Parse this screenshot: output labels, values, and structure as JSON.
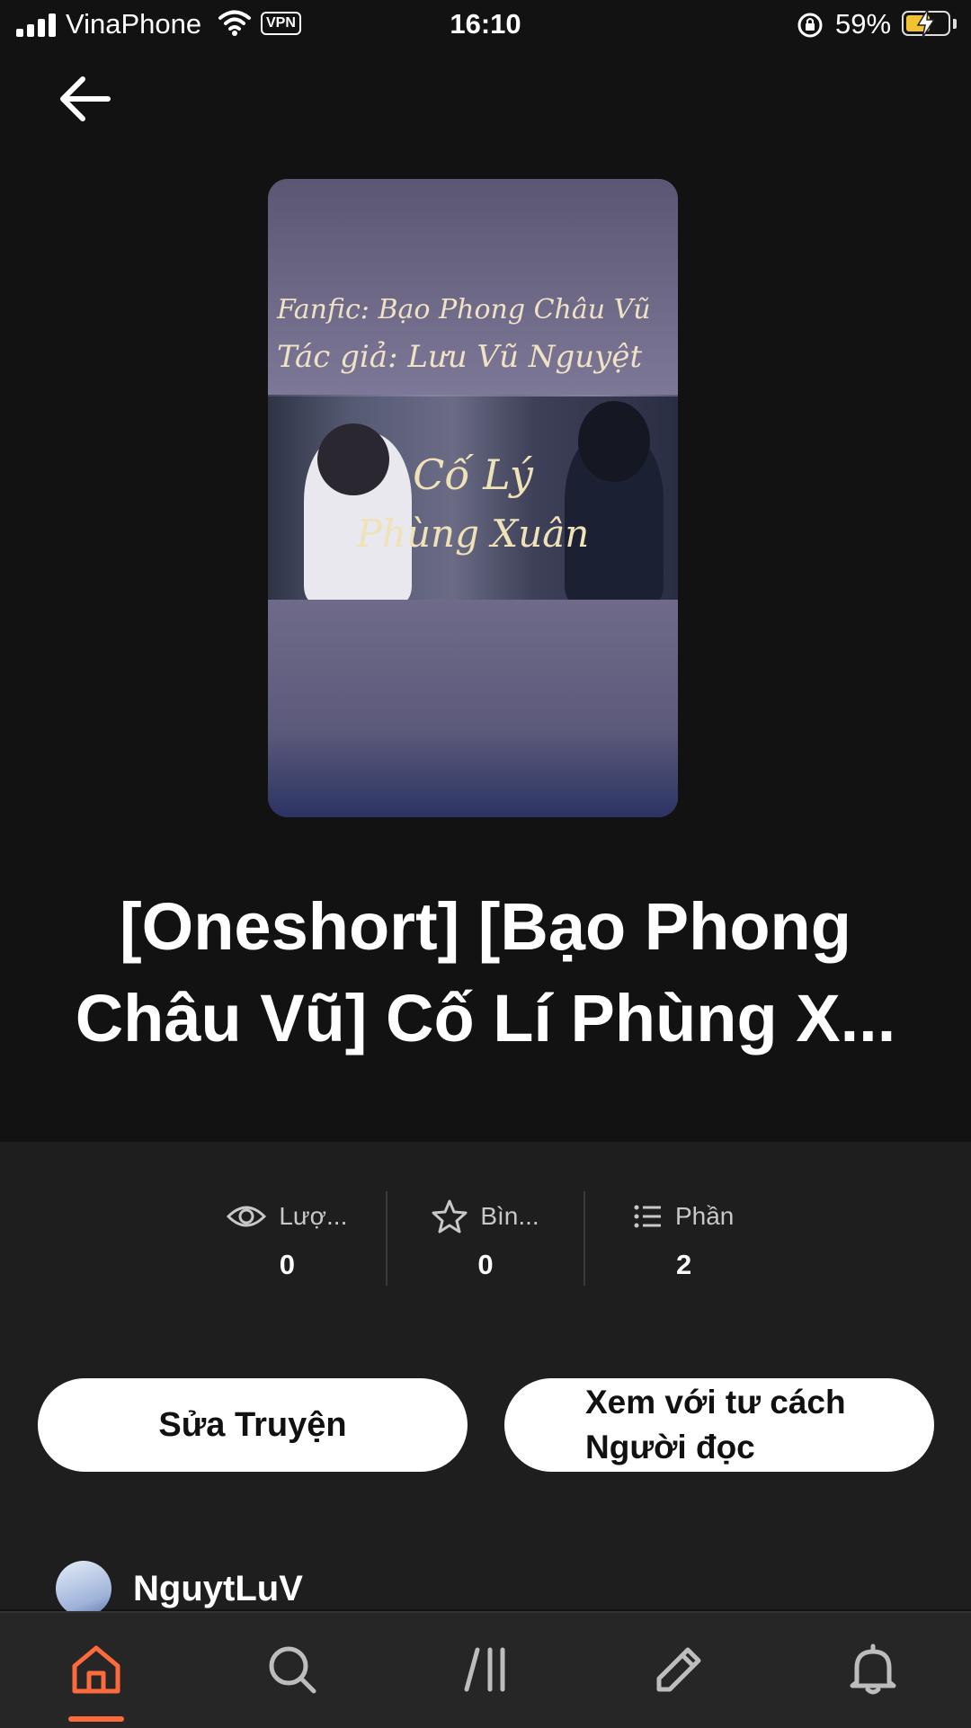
{
  "status_bar": {
    "carrier": "VinaPhone",
    "vpn": "VPN",
    "time": "16:10",
    "battery_percent": "59%",
    "battery_level": 0.59
  },
  "cover": {
    "line1": "Fanfic: Bạo Phong Châu Vũ",
    "line2": "Tác giả: Lưu Vũ Nguyệt",
    "title_line1": "Cố Lý",
    "title_line2": "Phùng Xuân"
  },
  "story": {
    "title_line1": "[Oneshort] [Bạo Phong",
    "title_line2": "Châu Vũ] Cố Lí Phùng X..."
  },
  "stats": [
    {
      "icon": "eye-icon",
      "label": "Lượ...",
      "value": "0"
    },
    {
      "icon": "star-icon",
      "label": "Bìn...",
      "value": "0"
    },
    {
      "icon": "list-icon",
      "label": "Phần",
      "value": "2"
    }
  ],
  "buttons": {
    "edit": "Sửa Truyện",
    "reader_line1": "Xem với tư cách",
    "reader_line2": "Người đọc"
  },
  "author": {
    "name": "NguytLuV"
  },
  "nav": {
    "items": [
      "home-icon",
      "search-icon",
      "library-icon",
      "write-icon",
      "bell-icon"
    ],
    "active": "home-icon",
    "active_color": "#ff6a3d"
  }
}
